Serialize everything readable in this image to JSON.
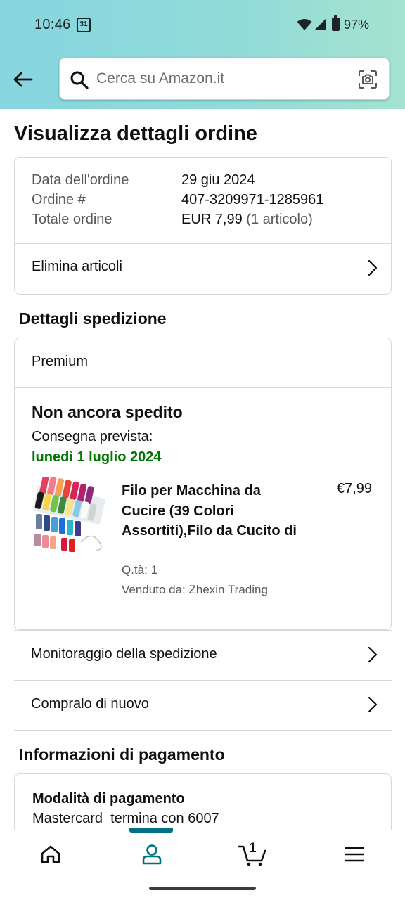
{
  "status_bar": {
    "time": "10:46",
    "calendar_day": "31",
    "battery": "97%"
  },
  "search": {
    "placeholder": "Cerca su Amazon.it"
  },
  "page": {
    "title": "Visualizza dettagli ordine"
  },
  "order_summary": {
    "rows": [
      {
        "label": "Data dell'ordine",
        "value": "29 giu 2024"
      },
      {
        "label": "Ordine #",
        "value": "407-3209971-1285961"
      },
      {
        "label": "Totale ordine",
        "value": "EUR 7,99",
        "extra": "(1 articolo)"
      }
    ],
    "delete_items": "Elimina articoli"
  },
  "shipping": {
    "section_title": "Dettagli spedizione",
    "type": "Premium",
    "status": "Non ancora spedito",
    "delivery_label": "Consegna prevista:",
    "delivery_date": "lunedì 1 luglio 2024",
    "product": {
      "title": "Filo per Macchina da Cucire (39 Colori Assortiti),Filo da Cucito di",
      "price": "€7,99",
      "qty": "Q.tà: 1",
      "seller": "Venduto da: Zhexin Trading"
    },
    "track": "Monitoraggio della spedizione",
    "buy_again": "Compralo di nuovo"
  },
  "payment": {
    "section_title": "Informazioni di pagamento",
    "method_title": "Modalità di pagamento",
    "method": "Mastercard  termina con 6007"
  },
  "bottom_nav": {
    "cart_count": "1",
    "active": "account"
  },
  "colors": {
    "accent": "#007185",
    "delivery_green": "#007600",
    "header_gradient_start": "#86d6e0",
    "header_gradient_end": "#a4e3cf"
  }
}
